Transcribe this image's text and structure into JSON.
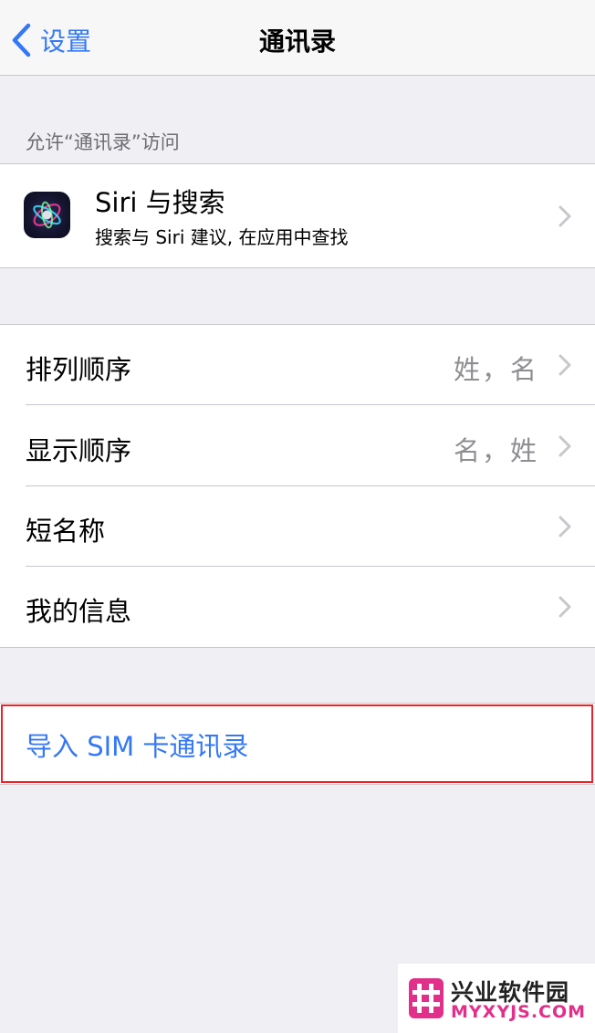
{
  "nav": {
    "back_label": "设置",
    "title": "通讯录"
  },
  "section_header": "允许“通讯录”访问",
  "siri": {
    "title": "Siri 与搜索",
    "subtitle": "搜索与 Siri 建议, 在应用中查找"
  },
  "rows": [
    {
      "label": "排列顺序",
      "value": "姓，名"
    },
    {
      "label": "显示顺序",
      "value": "名，姓"
    },
    {
      "label": "短名称",
      "value": ""
    },
    {
      "label": "我的信息",
      "value": ""
    }
  ],
  "import_sim": {
    "label": "导入 SIM 卡通讯录"
  },
  "watermark": {
    "title": "兴业软件园",
    "url": "MYXYJS.COM"
  },
  "colors": {
    "accent": "#3478f6",
    "highlight_border": "#e8242a",
    "background": "#efeff4",
    "watermark_pink": "#e2308a"
  }
}
